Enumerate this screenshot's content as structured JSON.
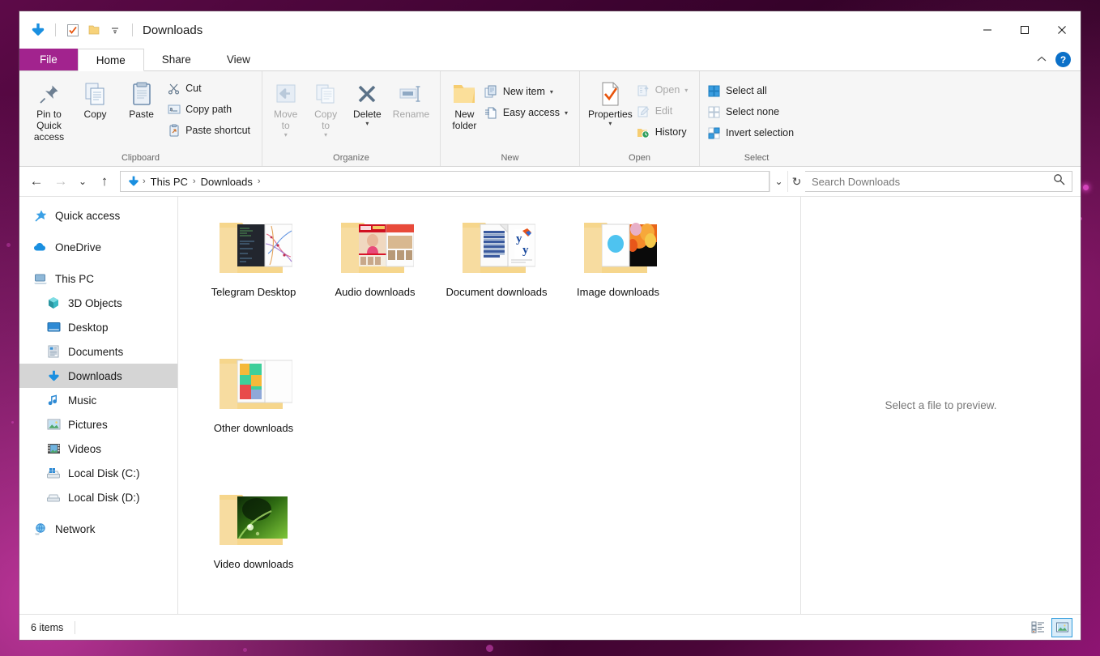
{
  "window": {
    "title": "Downloads",
    "quick_access_icons": [
      "downloads-arrow-icon",
      "checklist-icon",
      "folder-icon",
      "chevron-down-icon"
    ],
    "controls": {
      "minimize": "—",
      "maximize": "□",
      "close": "✕"
    }
  },
  "tabs": [
    {
      "label": "File",
      "kind": "file"
    },
    {
      "label": "Home",
      "kind": "active"
    },
    {
      "label": "Share",
      "kind": "normal"
    },
    {
      "label": "View",
      "kind": "normal"
    }
  ],
  "tab_right": {
    "collapse": "⌃",
    "help": "?"
  },
  "ribbon": {
    "groups": [
      {
        "label": "Clipboard",
        "big": [
          {
            "label": "Pin to Quick\naccess",
            "icon": "pin-icon",
            "disabled": false
          },
          {
            "label": "Copy",
            "icon": "copy-icon",
            "disabled": false
          },
          {
            "label": "Paste",
            "icon": "paste-icon",
            "disabled": false
          }
        ],
        "small": [
          {
            "label": "Cut",
            "icon": "scissors-icon",
            "disabled": false
          },
          {
            "label": "Copy path",
            "icon": "copy-path-icon",
            "disabled": false
          },
          {
            "label": "Paste shortcut",
            "icon": "paste-shortcut-icon",
            "disabled": false
          }
        ]
      },
      {
        "label": "Organize",
        "big": [
          {
            "label": "Move\nto",
            "icon": "move-to-icon",
            "disabled": true,
            "caret": true
          },
          {
            "label": "Copy\nto",
            "icon": "copy-to-icon",
            "disabled": true,
            "caret": true
          },
          {
            "label": "Delete",
            "icon": "delete-x-icon",
            "disabled": false,
            "caret": true
          },
          {
            "label": "Rename",
            "icon": "rename-icon",
            "disabled": true
          }
        ],
        "small": []
      },
      {
        "label": "New",
        "big": [
          {
            "label": "New\nfolder",
            "icon": "new-folder-icon",
            "disabled": false
          }
        ],
        "small": [
          {
            "label": "New item",
            "icon": "new-item-icon",
            "disabled": false,
            "caret": true
          },
          {
            "label": "Easy access",
            "icon": "easy-access-icon",
            "disabled": false,
            "caret": true
          }
        ]
      },
      {
        "label": "Open",
        "big": [
          {
            "label": "Properties",
            "icon": "properties-icon",
            "disabled": false,
            "caret_below": true
          }
        ],
        "small": [
          {
            "label": "Open",
            "icon": "open-icon",
            "disabled": true,
            "caret": true
          },
          {
            "label": "Edit",
            "icon": "edit-icon",
            "disabled": true
          },
          {
            "label": "History",
            "icon": "history-icon",
            "disabled": false
          }
        ]
      },
      {
        "label": "Select",
        "big": [],
        "small": [
          {
            "label": "Select all",
            "icon": "select-all-icon",
            "disabled": false
          },
          {
            "label": "Select none",
            "icon": "select-none-icon",
            "disabled": false
          },
          {
            "label": "Invert selection",
            "icon": "invert-selection-icon",
            "disabled": false
          }
        ]
      }
    ]
  },
  "address": {
    "back": "←",
    "forward": "→",
    "recent": "⌄",
    "up": "↑",
    "crumbs": [
      "This PC",
      "Downloads"
    ],
    "separator": "›",
    "dropdown": "⌄",
    "refresh": "↻"
  },
  "search": {
    "placeholder": "Search Downloads",
    "value": "",
    "icon": "search-icon"
  },
  "sidebar": {
    "items": [
      {
        "label": "Quick access",
        "icon": "star-pin-icon",
        "indent": false,
        "selected": false,
        "gap_after": true
      },
      {
        "label": "OneDrive",
        "icon": "cloud-icon",
        "indent": false,
        "selected": false,
        "gap_after": true
      },
      {
        "label": "This PC",
        "icon": "computer-icon",
        "indent": false,
        "selected": false
      },
      {
        "label": "3D Objects",
        "icon": "cube-icon",
        "indent": true,
        "selected": false
      },
      {
        "label": "Desktop",
        "icon": "desktop-icon",
        "indent": true,
        "selected": false
      },
      {
        "label": "Documents",
        "icon": "documents-icon",
        "indent": true,
        "selected": false
      },
      {
        "label": "Downloads",
        "icon": "downloads-arrow-icon",
        "indent": true,
        "selected": true
      },
      {
        "label": "Music",
        "icon": "music-note-icon",
        "indent": true,
        "selected": false
      },
      {
        "label": "Pictures",
        "icon": "pictures-icon",
        "indent": true,
        "selected": false
      },
      {
        "label": "Videos",
        "icon": "videos-icon",
        "indent": true,
        "selected": false
      },
      {
        "label": "Local Disk (C:)",
        "icon": "windows-drive-icon",
        "indent": true,
        "selected": false
      },
      {
        "label": "Local Disk (D:)",
        "icon": "drive-icon",
        "indent": true,
        "selected": false,
        "gap_after": true
      },
      {
        "label": "Network",
        "icon": "network-icon",
        "indent": false,
        "selected": false
      }
    ]
  },
  "files": {
    "items": [
      {
        "name": "Telegram Desktop",
        "type": "folder",
        "thumb": "code-map-thumb"
      },
      {
        "name": "Audio downloads",
        "type": "folder",
        "thumb": "poster-thumb"
      },
      {
        "name": "Document downloads",
        "type": "folder",
        "thumb": "document-thumb"
      },
      {
        "name": "Image downloads",
        "type": "folder",
        "thumb": "photo-thumb"
      },
      {
        "name": "Other downloads",
        "type": "folder",
        "thumb": "colorblocks-thumb"
      },
      {
        "name": "Video downloads",
        "type": "folder",
        "thumb": "leaf-thumb"
      }
    ]
  },
  "preview": {
    "message": "Select a file to preview."
  },
  "status": {
    "item_count": "6 items",
    "views": [
      {
        "name": "details-view-button",
        "selected": false
      },
      {
        "name": "large-icons-view-button",
        "selected": true
      }
    ]
  },
  "colors": {
    "file_tab": "#a2238e",
    "accent_blue": "#0b70c8",
    "selection": "#d5d5d5",
    "folder_yellow": "#fbdf9a",
    "desktop": "#3d0330"
  }
}
